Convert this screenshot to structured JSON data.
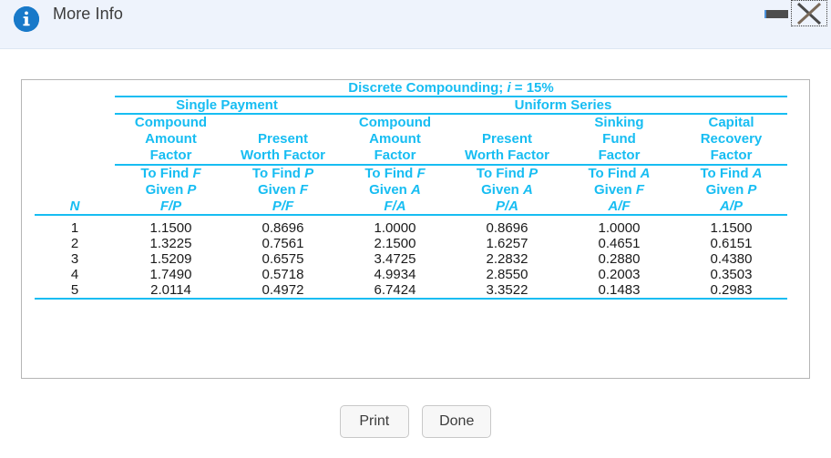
{
  "window": {
    "title": "More Info",
    "info_icon": "info-circle-icon",
    "minimize_label": "–",
    "close_label": "✕"
  },
  "table": {
    "title_prefix": "Discrete Compounding; ",
    "title_i": "i",
    "title_rate": " = 15%",
    "groups": [
      {
        "label": "Single Payment",
        "span": 2
      },
      {
        "label": "Uniform Series",
        "span": 4
      }
    ],
    "index_header": "N",
    "columns": [
      {
        "name_line1": "Compound",
        "name_line2": "Amount",
        "name_line3": "Factor",
        "find_line": "To Find ",
        "find_var": "F",
        "given_line": "Given ",
        "given_var": "P",
        "symbol": "F/P"
      },
      {
        "name_line1": "",
        "name_line2": "Present",
        "name_line3": "Worth Factor",
        "find_line": "To Find ",
        "find_var": "P",
        "given_line": "Given ",
        "given_var": "F",
        "symbol": "P/F"
      },
      {
        "name_line1": "Compound",
        "name_line2": "Amount",
        "name_line3": "Factor",
        "find_line": "To Find ",
        "find_var": "F",
        "given_line": "Given ",
        "given_var": "A",
        "symbol": "F/A"
      },
      {
        "name_line1": "",
        "name_line2": "Present",
        "name_line3": "Worth Factor",
        "find_line": "To Find ",
        "find_var": "P",
        "given_line": "Given ",
        "given_var": "A",
        "symbol": "P/A"
      },
      {
        "name_line1": "Sinking",
        "name_line2": "Fund",
        "name_line3": "Factor",
        "find_line": "To Find ",
        "find_var": "A",
        "given_line": "Given ",
        "given_var": "F",
        "symbol": "A/F"
      },
      {
        "name_line1": "Capital",
        "name_line2": "Recovery",
        "name_line3": "Factor",
        "find_line": "To Find ",
        "find_var": "A",
        "given_line": "Given ",
        "given_var": "P",
        "symbol": "A/P"
      }
    ],
    "rows": [
      {
        "n": "1",
        "v": [
          "1.1500",
          "0.8696",
          "1.0000",
          "0.8696",
          "1.0000",
          "1.1500"
        ]
      },
      {
        "n": "2",
        "v": [
          "1.3225",
          "0.7561",
          "2.1500",
          "1.6257",
          "0.4651",
          "0.6151"
        ]
      },
      {
        "n": "3",
        "v": [
          "1.5209",
          "0.6575",
          "3.4725",
          "2.2832",
          "0.2880",
          "0.4380"
        ]
      },
      {
        "n": "4",
        "v": [
          "1.7490",
          "0.5718",
          "4.9934",
          "2.8550",
          "0.2003",
          "0.3503"
        ]
      },
      {
        "n": "5",
        "v": [
          "2.0114",
          "0.4972",
          "6.7424",
          "3.3522",
          "0.1483",
          "0.2983"
        ]
      }
    ]
  },
  "buttons": {
    "print": "Print",
    "done": "Done"
  },
  "colors": {
    "accent_cyan": "#17bdf2",
    "titlebar_bg": "#eef3fc",
    "info_blue": "#1879c9"
  }
}
